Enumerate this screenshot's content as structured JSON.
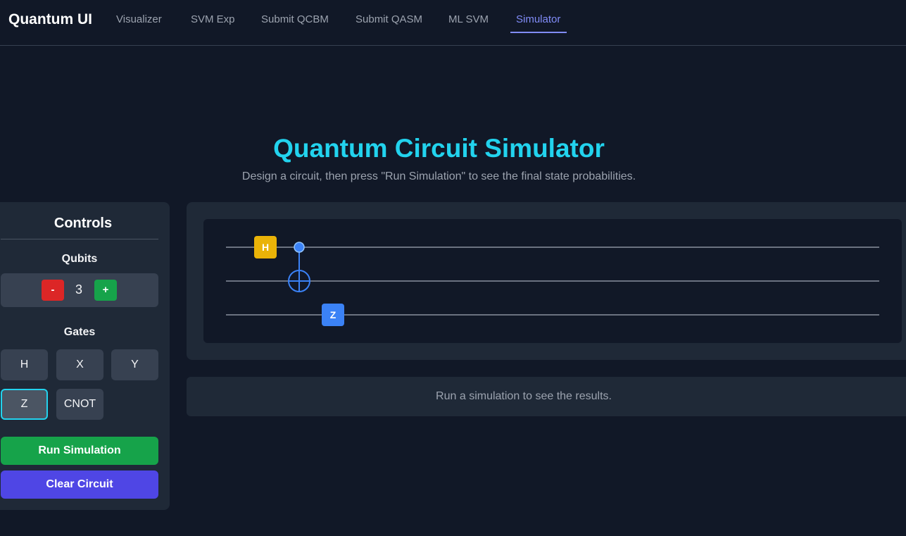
{
  "app": {
    "brand": "Quantum UI"
  },
  "nav": {
    "items": [
      {
        "label": "Visualizer"
      },
      {
        "label": "SVM Exp"
      },
      {
        "label": "Submit QCBM"
      },
      {
        "label": "Submit QASM"
      },
      {
        "label": "ML SVM"
      },
      {
        "label": "Simulator",
        "active": true
      }
    ]
  },
  "header": {
    "title": "Quantum Circuit Simulator",
    "subtitle": "Design a circuit, then press \"Run Simulation\" to see the final state probabilities."
  },
  "controls": {
    "title": "Controls",
    "qubits_label": "Qubits",
    "minus_label": "-",
    "plus_label": "+",
    "qubit_count": "3",
    "gates_label": "Gates",
    "gates": [
      "H",
      "X",
      "Y",
      "Z",
      "CNOT"
    ],
    "selected_gate": "Z",
    "run_label": "Run Simulation",
    "clear_label": "Clear Circuit"
  },
  "circuit": {
    "qubits": 3,
    "placed_gates": [
      {
        "type": "H",
        "qubit": 0,
        "label": "H",
        "color": "#eab308"
      },
      {
        "type": "CNOT",
        "control": 0,
        "target": 1,
        "color": "#3b82f6"
      },
      {
        "type": "Z",
        "qubit": 2,
        "label": "Z",
        "color": "#3b82f6"
      }
    ]
  },
  "results": {
    "message": "Run a simulation to see the results."
  },
  "colors": {
    "accent": "#818cf8",
    "title": "#22d3ee",
    "run": "#16a34a",
    "clear": "#4f46e5",
    "minus": "#dc2626",
    "plus": "#16a34a"
  }
}
